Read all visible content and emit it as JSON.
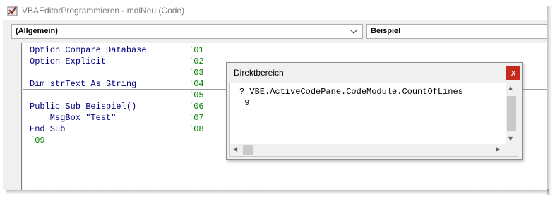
{
  "window": {
    "title": "VBAEditorProgrammieren - mdlNeu (Code)"
  },
  "object_combo": {
    "value": "(Allgemein)"
  },
  "procedure_combo": {
    "value": "Beispiel"
  },
  "code": [
    {
      "code": "Option Compare Database",
      "comment": "'01"
    },
    {
      "code": "Option Explicit",
      "comment": "'02"
    },
    {
      "code": "",
      "comment": "'03"
    },
    {
      "code": "Dim strText As String",
      "comment": "'04"
    },
    {
      "code": "",
      "comment": "'05"
    },
    {
      "code": "Public Sub Beispiel()",
      "comment": "'06"
    },
    {
      "code": "    MsgBox \"Test\"",
      "comment": "'07"
    },
    {
      "code": "End Sub",
      "comment": "'08"
    },
    {
      "code": "",
      "comment": "'09"
    }
  ],
  "immediate_window": {
    "title": "Direktbereich",
    "close_label": "x",
    "lines": [
      "? VBE.ActiveCodePane.CodeModule.CountOfLines",
      " 9"
    ]
  },
  "colors": {
    "keyword": "#00007f",
    "comment": "#007f00",
    "close_button": "#c42b1c"
  }
}
